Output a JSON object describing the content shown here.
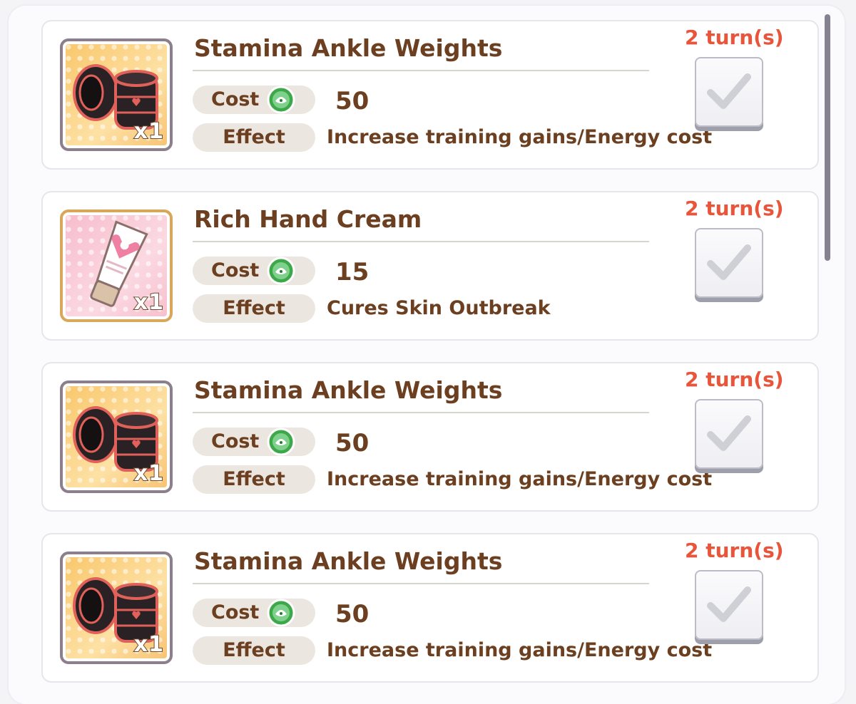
{
  "items": [
    {
      "name": "Stamina Ankle Weights",
      "quantity": "x1",
      "cost_label": "Cost",
      "cost": "50",
      "effect_label": "Effect",
      "effect": "Increase training gains/Energy cost",
      "turns": "2 turn(s)",
      "icon": "ankle-weights-icon",
      "checked": false
    },
    {
      "name": "Rich Hand Cream",
      "quantity": "x1",
      "cost_label": "Cost",
      "cost": "15",
      "effect_label": "Effect",
      "effect": "Cures Skin Outbreak",
      "turns": "2 turn(s)",
      "icon": "hand-cream-icon",
      "checked": false
    },
    {
      "name": "Stamina Ankle Weights",
      "quantity": "x1",
      "cost_label": "Cost",
      "cost": "50",
      "effect_label": "Effect",
      "effect": "Increase training gains/Energy cost",
      "turns": "2 turn(s)",
      "icon": "ankle-weights-icon",
      "checked": false
    },
    {
      "name": "Stamina Ankle Weights",
      "quantity": "x1",
      "cost_label": "Cost",
      "cost": "50",
      "effect_label": "Effect",
      "effect": "Increase training gains/Energy cost",
      "turns": "2 turn(s)",
      "icon": "ankle-weights-icon",
      "checked": false
    }
  ],
  "colors": {
    "text_brown": "#6b3f1f",
    "turns_orange": "#e8553a",
    "coin_green": "#3da84a"
  }
}
